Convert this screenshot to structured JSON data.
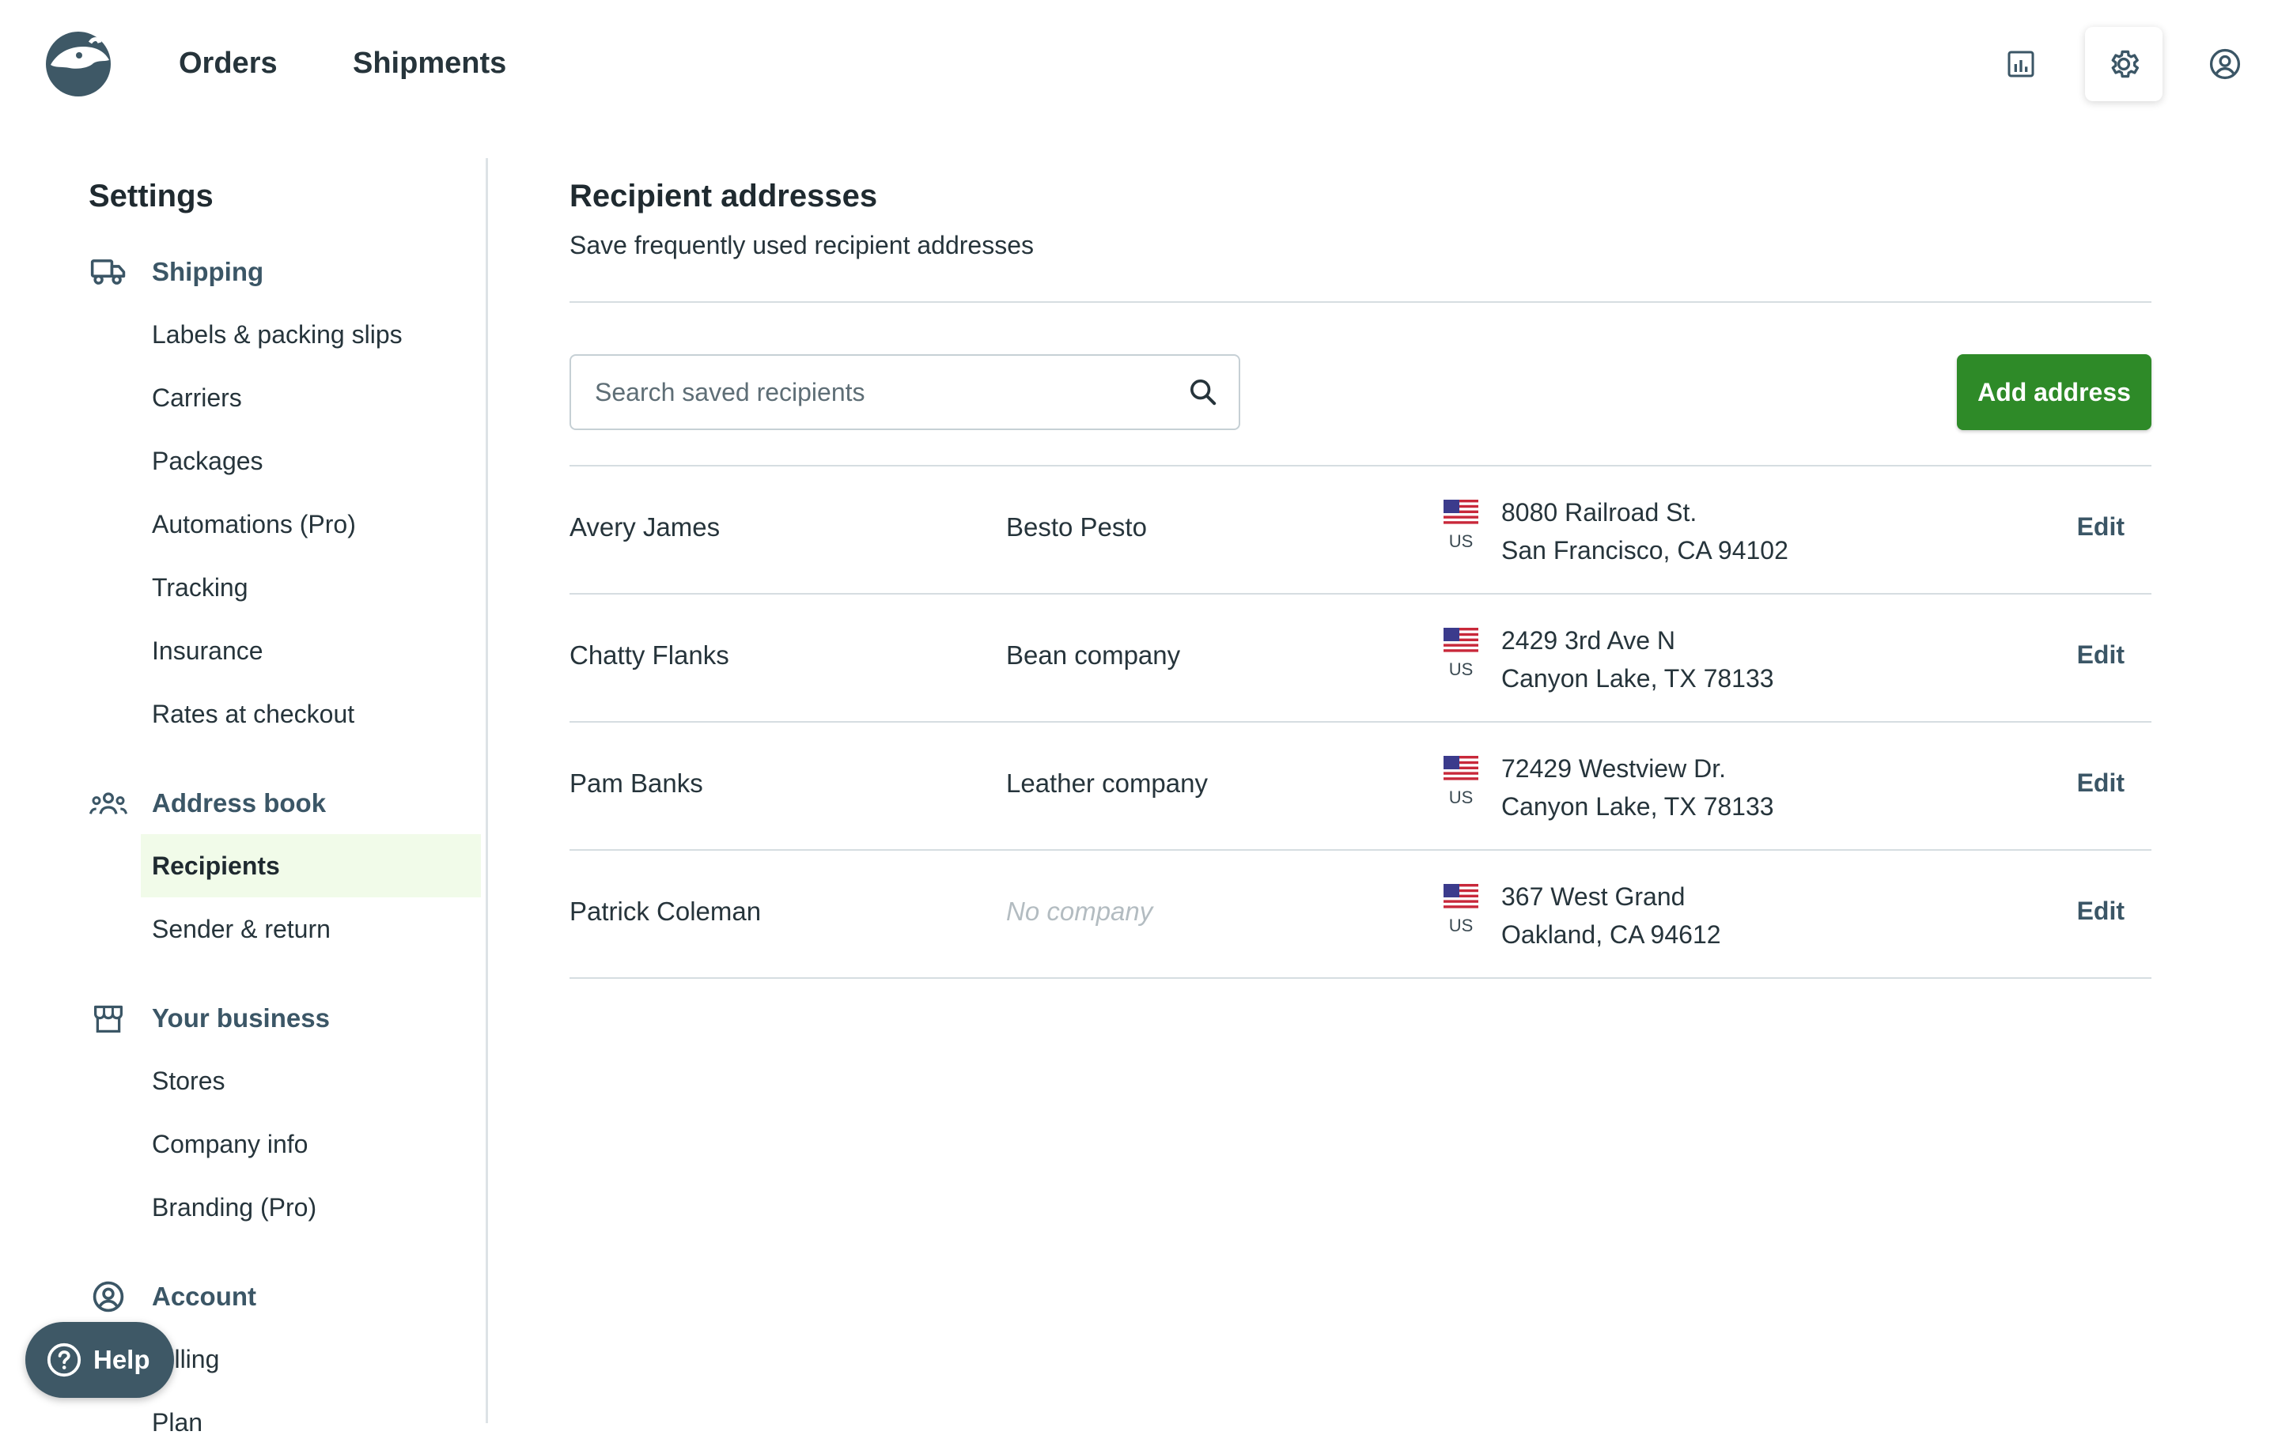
{
  "topnav": {
    "orders": "Orders",
    "shipments": "Shipments",
    "icons": [
      "reports-icon",
      "gear-icon",
      "user-circle-icon"
    ]
  },
  "sidebar": {
    "title": "Settings",
    "sections": [
      {
        "label": "Shipping",
        "icon": "truck-icon",
        "items": [
          "Labels & packing slips",
          "Carriers",
          "Packages",
          "Automations (Pro)",
          "Tracking",
          "Insurance",
          "Rates at checkout"
        ]
      },
      {
        "label": "Address book",
        "icon": "people-icon",
        "items": [
          "Recipients",
          "Sender & return"
        ],
        "active": "Recipients"
      },
      {
        "label": "Your business",
        "icon": "store-icon",
        "items": [
          "Stores",
          "Company info",
          "Branding (Pro)"
        ]
      },
      {
        "label": "Account",
        "icon": "user-circle-icon",
        "items": [
          "Billing",
          "Plan"
        ]
      }
    ]
  },
  "main": {
    "title": "Recipient addresses",
    "subtitle": "Save frequently used recipient addresses",
    "search_placeholder": "Search saved recipients",
    "add_button": "Add address",
    "edit_label": "Edit",
    "recipients": [
      {
        "name": "Avery James",
        "company": "Besto Pesto",
        "country": "US",
        "line1": "8080 Railroad St.",
        "line2": "San Francisco, CA 94102"
      },
      {
        "name": "Chatty Flanks",
        "company": "Bean company",
        "country": "US",
        "line1": "2429 3rd Ave N",
        "line2": "Canyon Lake, TX 78133"
      },
      {
        "name": "Pam Banks",
        "company": "Leather company",
        "country": "US",
        "line1": "72429 Westview Dr.",
        "line2": "Canyon Lake, TX 78133"
      },
      {
        "name": "Patrick Coleman",
        "company": "No company",
        "country": "US",
        "line1": "367 West Grand",
        "line2": "Oakland, CA 94612"
      }
    ]
  },
  "help": {
    "label": "Help"
  },
  "colors": {
    "accent_green": "#2e8a28",
    "nav_slate": "#3b5666",
    "active_bg": "#f1fbe9",
    "help_bg": "#3e5866"
  }
}
